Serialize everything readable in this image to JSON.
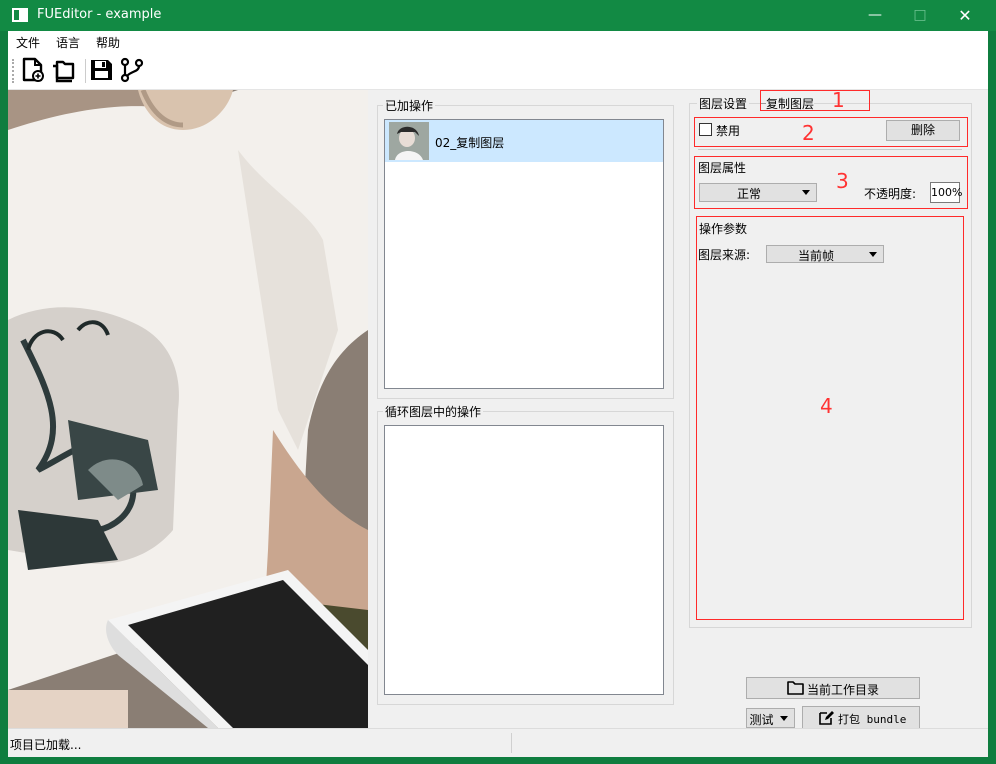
{
  "window": {
    "title": "FUEditor - example"
  },
  "menu": {
    "items": [
      "文件",
      "语言",
      "帮助"
    ]
  },
  "toolbar": {
    "icons": [
      "new-file-icon",
      "open-folder-icon",
      "save-icon",
      "branch-icon"
    ]
  },
  "added_ops": {
    "title": "已加操作",
    "items": [
      {
        "label": "02_复制图层",
        "selected": true
      }
    ]
  },
  "loop_ops": {
    "title": "循环图层中的操作"
  },
  "layer_settings": {
    "title": "图层设置",
    "layer_name": "复制图层",
    "disable_label": "禁用",
    "disable_checked": false,
    "delete_label": "删除",
    "props_title": "图层属性",
    "blend_mode": "正常",
    "opacity_label": "不透明度:",
    "opacity_value": "100%",
    "params_title": "操作参数",
    "source_label": "图层来源:",
    "source_value": "当前帧"
  },
  "annotations": [
    "1",
    "2",
    "3",
    "4"
  ],
  "bottom": {
    "workdir_label": "当前工作目录",
    "mode_value": "测试",
    "pack_label": "打包 bundle"
  },
  "status": {
    "text": "项目已加载..."
  },
  "colors": {
    "titlebar": "#128a44",
    "selection": "#cce8ff",
    "annotation": "#ff2a2a"
  }
}
